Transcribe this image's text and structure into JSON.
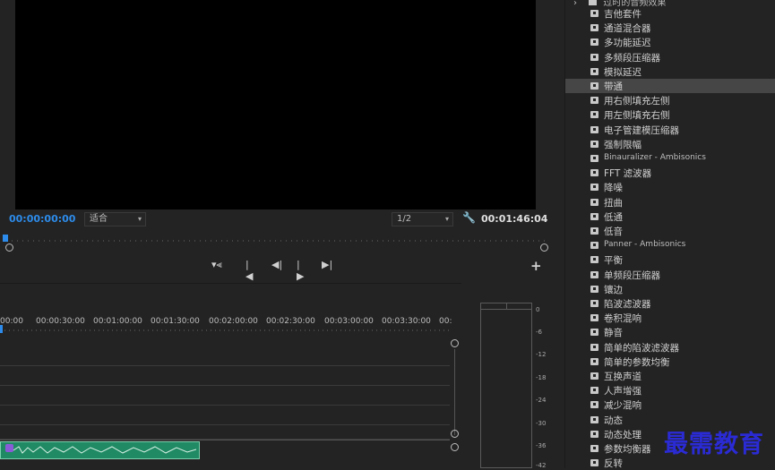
{
  "monitor": {
    "timecode_current": "00:00:00:00",
    "fit_value": "适合",
    "resolution_value": "1/2",
    "timecode_duration": "00:01:46:04",
    "icons": [
      "wrench-icon",
      "insert-marker-icon",
      "step-to-in-icon",
      "step-back-icon",
      "play-icon",
      "step-to-out-icon",
      "add-button-icon"
    ],
    "add_label": "+"
  },
  "timeline": {
    "time_labels": [
      "00:00",
      "00:00:30:00",
      "00:01:00:00",
      "00:01:30:00",
      "00:02:00:00",
      "00:02:30:00",
      "00:03:00:00",
      "00:03:30:00",
      "00:"
    ]
  },
  "meter": {
    "db_labels": [
      "0",
      "-6",
      "-12",
      "-18",
      "-24",
      "-30",
      "-36",
      "-42"
    ]
  },
  "effects": {
    "header": "过时的音频效果",
    "selected_index": 5,
    "items": [
      "吉他套件",
      "通道混合器",
      "多功能延迟",
      "多频段压缩器",
      "模拟延迟",
      "带通",
      "用右侧填充左侧",
      "用左侧填充右侧",
      "电子管建模压缩器",
      "强制限幅",
      "Binauralizer - Ambisonics",
      "FFT 滤波器",
      "降噪",
      "扭曲",
      "低通",
      "低音",
      "Panner - Ambisonics",
      "平衡",
      "单频段压缩器",
      "镶边",
      "陷波滤波器",
      "卷积混响",
      "静音",
      "简单的陷波滤波器",
      "简单的参数均衡",
      "互换声道",
      "人声增强",
      "减少混响",
      "动态",
      "动态处理",
      "参数均衡器",
      "反转"
    ]
  },
  "watermark": "最需教育"
}
